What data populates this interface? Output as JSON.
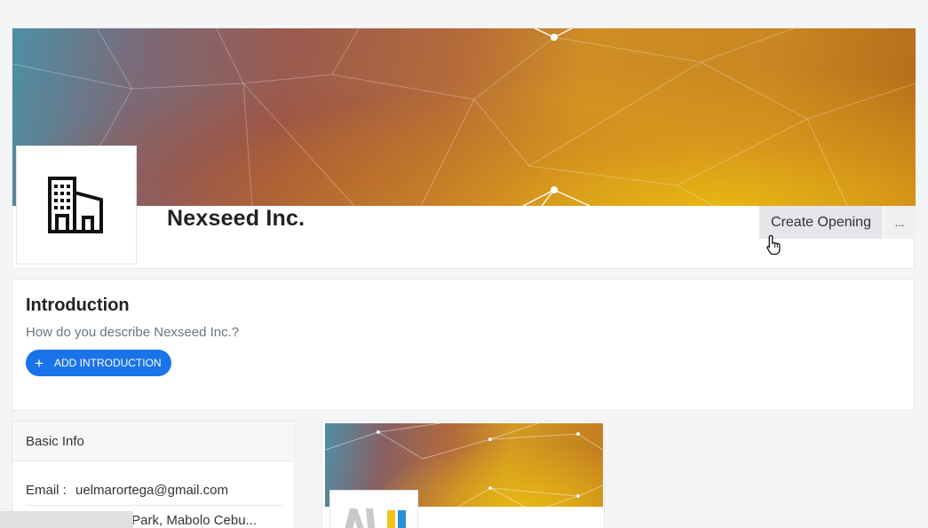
{
  "company": {
    "name": "Nexseed Inc.",
    "create_opening_label": "Create Opening",
    "more_label": "..."
  },
  "introduction": {
    "title": "Introduction",
    "question": "How do you describe Nexseed Inc.?",
    "add_button_label": "ADD INTRODUCTION"
  },
  "basic_info": {
    "title": "Basic Info",
    "email_label": "Email :",
    "email_value": "uelmarortega@gmail.com",
    "address_partial": "ss Park, Mabolo Cebu..."
  },
  "colors": {
    "accent_blue": "#1a73e8",
    "button_gray": "#e4e6ea",
    "banner_gold": "#d6a41a",
    "banner_teal": "#4e8fa6"
  },
  "icons": {
    "logo": "building-icon",
    "add": "plus-icon",
    "cursor": "hand-pointer-icon"
  }
}
